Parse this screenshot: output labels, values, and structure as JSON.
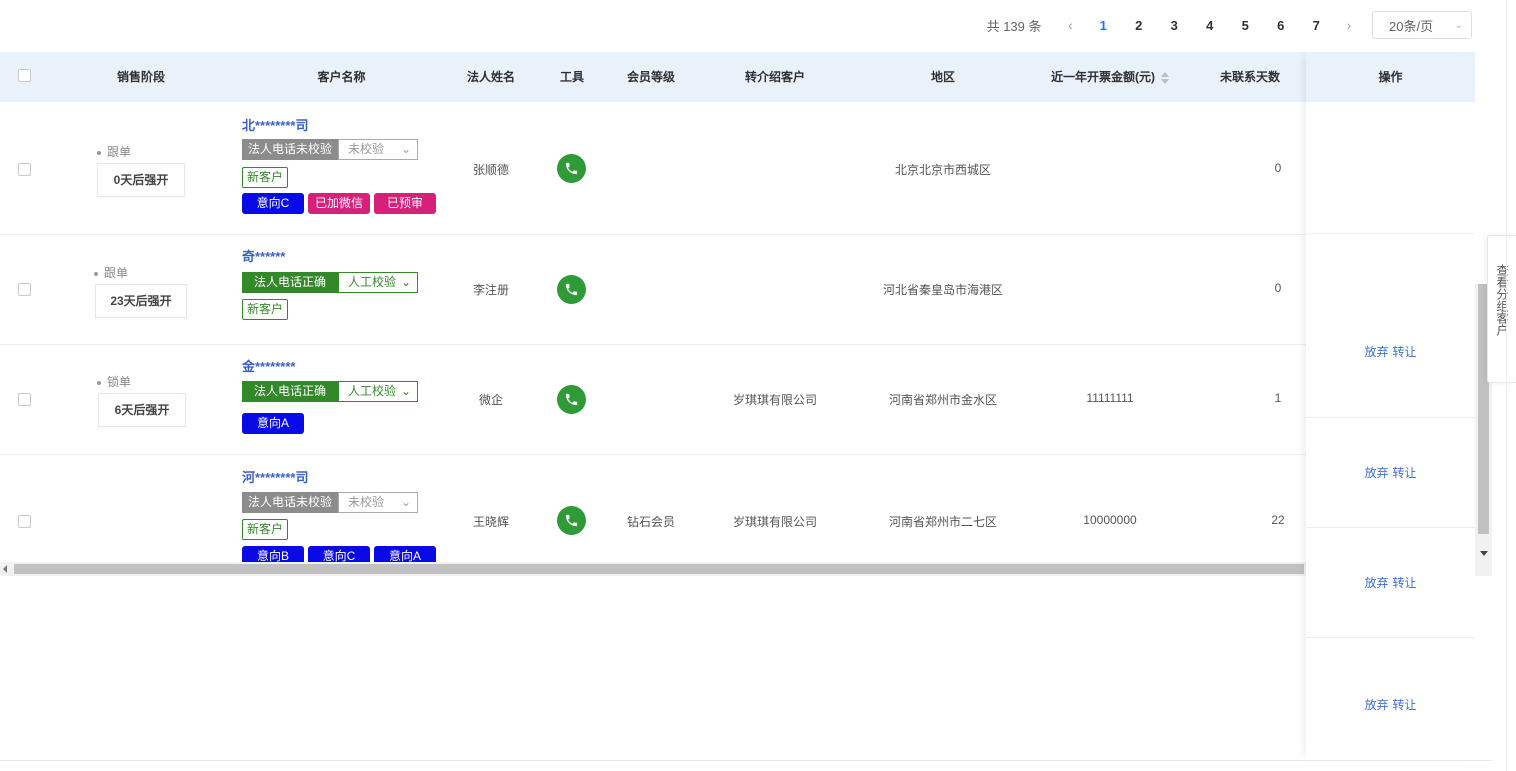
{
  "pagination": {
    "total_label": "共 139 条",
    "pages": [
      "1",
      "2",
      "3",
      "4",
      "5",
      "6",
      "7"
    ],
    "current": "1",
    "page_size": "20条/页"
  },
  "table": {
    "headers": {
      "stage": "销售阶段",
      "name": "客户名称",
      "legal": "法人姓名",
      "tool": "工具",
      "member": "会员等级",
      "referral": "转介绍客户",
      "region": "地区",
      "amount": "近一年开票金额(元)",
      "days": "未联系天数",
      "ops": "操作"
    },
    "rows": [
      {
        "stage": "跟单",
        "stage_box": "0天后强开",
        "name": "北********司",
        "verify_label": "法人电话未校验",
        "verify_select": "未校验",
        "new_tag": "新客户",
        "tags": [
          "意向C",
          "已加微信",
          "已预审"
        ],
        "legal": "张顺德",
        "member": "",
        "referral": "",
        "region": "北京北京市西城区",
        "amount": "",
        "days": "0"
      },
      {
        "stage": "跟单",
        "stage_box": "23天后强开",
        "name": "奇******",
        "verify_label": "法人电话正确",
        "verify_select": "人工校验",
        "new_tag": "新客户",
        "tags": [],
        "legal": "李注册",
        "member": "",
        "referral": "",
        "region": "河北省秦皇岛市海港区",
        "amount": "",
        "days": "0"
      },
      {
        "stage": "锁单",
        "stage_box": "6天后强开",
        "name": "金********",
        "verify_label": "法人电话正确",
        "verify_select": "人工校验",
        "new_tag": "",
        "tags": [
          "意向A"
        ],
        "legal": "微企",
        "member": "",
        "referral": "岁琪琪有限公司",
        "region": "河南省郑州市金水区",
        "amount": "11111111",
        "days": "1"
      },
      {
        "stage": "",
        "stage_box": "",
        "name": "河********司",
        "verify_label": "法人电话未校验",
        "verify_select": "未校验",
        "new_tag": "新客户",
        "tags": [
          "意向B",
          "意向C",
          "意向A"
        ],
        "legal": "王晓辉",
        "member": "钻石会员",
        "referral": "岁琪琪有限公司",
        "region": "河南省郑州市二七区",
        "amount": "10000000",
        "days": "22"
      }
    ],
    "ops": {
      "abandon": "放弃",
      "transfer": "转让"
    }
  },
  "side_tab": "查看分组客户",
  "colors": {
    "header_bg": "#e9f1fb",
    "link": "#3a6fd8",
    "green": "#33892a",
    "gray_label": "#8c8c8c",
    "intent_blue": "#0a0ae6",
    "magenta": "#d5217a",
    "phone_green": "#2f9a38"
  }
}
